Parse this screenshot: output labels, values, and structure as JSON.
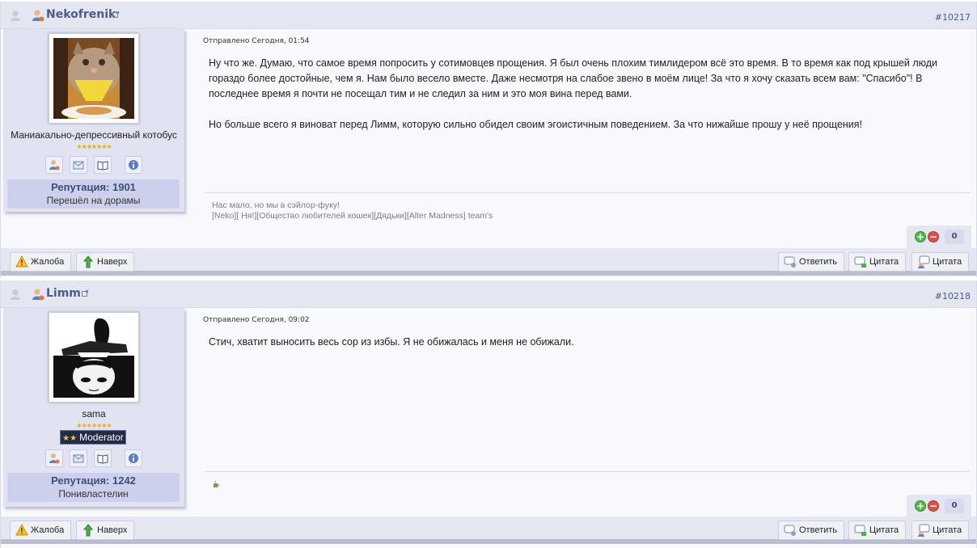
{
  "posts": [
    {
      "nick": "Nekofrenik",
      "post_number": "#10217",
      "user_title": "Маниакально-депрессивный котобус",
      "stars": "★★★★★★★",
      "reputation_label": "Репутация: 1901",
      "reputation_sub": "Перешёл на дорамы",
      "posted": "Отправлено Сегодня, 01:54",
      "paragraphs": [
        "Ну что же. Думаю, что самое время попросить у сотимовцев прощения. Я был очень плохим тимлидером всё это время. В то время как под крышей люди гораздо более достойные, чем я. Нам было весело вместе. Даже несмотря на слабое звено в моём лице! За что я хочу сказать всем вам: \"Спасибо\"! В последнее время я почти не посещал тим и не следил за ним и это моя вина перед вами.",
        "Но больше всего я виноват перед Лимм, которую сильно обидел своим эгоистичным поведением. За что нижайше прошу у неё прощения!"
      ],
      "signature": [
        "Нас мало, но мы в сэйлор-фуку!",
        "[Neko][ Ня!][Общество любителей кошек][Дядьки][Alter Madness] team's"
      ],
      "rep_count": "0"
    },
    {
      "nick": "Limm",
      "post_number": "#10218",
      "user_title": "sama",
      "stars": "★★★★★★★",
      "badge": "Moderator",
      "badge_stars": "★★",
      "reputation_label": "Репутация: 1242",
      "reputation_sub": "Понивластелин",
      "posted": "Отправлено Сегодня, 09:02",
      "paragraphs": [
        "Стич, хватит выносить весь сор из избы. Я не обижалась и меня не обижали."
      ],
      "signature_icon": "coffee-icon",
      "rep_count": "0"
    }
  ],
  "buttons": {
    "report": "Жалоба",
    "top": "Наверх",
    "reply": "Ответить",
    "quote_multi": "Цитата",
    "quote": "Цитата"
  }
}
